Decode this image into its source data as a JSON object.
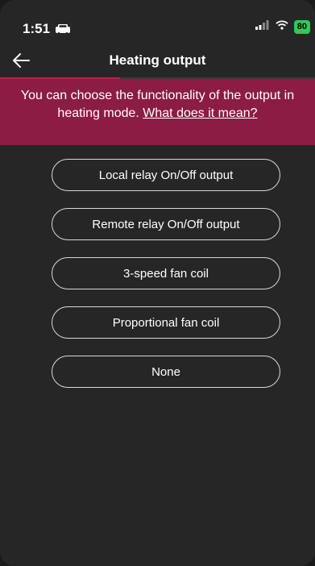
{
  "status_bar": {
    "time": "1:51",
    "battery": "80"
  },
  "header": {
    "title": "Heating output"
  },
  "progress": {
    "fraction": 0.38
  },
  "info": {
    "text": "You can choose the functionality of the output in heating mode. ",
    "link": "What does it mean?"
  },
  "options": [
    {
      "label": "Local relay On/Off output"
    },
    {
      "label": "Remote relay On/Off output"
    },
    {
      "label": "3-speed fan coil"
    },
    {
      "label": "Proportional fan coil"
    },
    {
      "label": "None"
    }
  ],
  "colors": {
    "accent": "#c0204a",
    "banner": "#8b1c43",
    "background": "#262626"
  },
  "icons": {
    "back": "arrow-left-icon",
    "car": "car-icon",
    "signal": "signal-icon",
    "wifi": "wifi-icon",
    "battery": "battery-icon"
  }
}
